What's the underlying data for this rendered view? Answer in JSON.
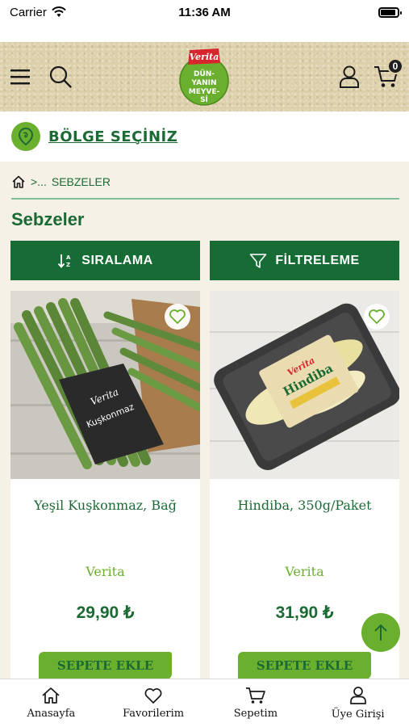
{
  "status_bar": {
    "carrier": "Carrier",
    "time": "11:36 AM"
  },
  "header": {
    "logo": {
      "brand": "Verita",
      "text": "DÜNYANIN MEYVESİ"
    },
    "cart_count": "0"
  },
  "region": {
    "label": "BÖLGE SEÇİNİZ"
  },
  "breadcrumb": {
    "separator": ">...",
    "current": "SEBZELER"
  },
  "page": {
    "title": "Sebzeler"
  },
  "actions": {
    "sort_label": "SIRALAMA",
    "filter_label": "FİLTRELEME"
  },
  "products": [
    {
      "name": "Yeşil Kuşkonmaz, Bağ",
      "brand": "Verita",
      "price": "29,90 ₺",
      "add_label": "SEPETE EKLE",
      "package_label": "Kuşkonmaz"
    },
    {
      "name": "Hindiba, 350g/Paket",
      "brand": "Verita",
      "price": "31,90 ₺",
      "add_label": "SEPETE EKLE",
      "package_label": "Hindiba"
    }
  ],
  "tabbar": {
    "items": [
      {
        "label": "Anasayfa",
        "icon": "home-icon"
      },
      {
        "label": "Favorilerim",
        "icon": "heart-icon"
      },
      {
        "label": "Sepetim",
        "icon": "cart-icon"
      },
      {
        "label": "Üye Girişi",
        "icon": "user-icon"
      }
    ]
  },
  "colors": {
    "primary_green": "#176c35",
    "accent_green": "#6ab02e",
    "background": "#f5f1e6"
  }
}
